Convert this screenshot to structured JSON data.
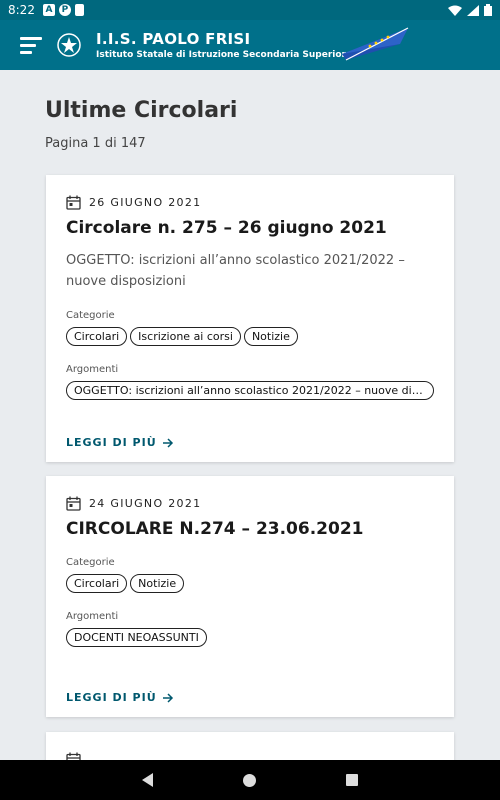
{
  "status_bar": {
    "time": "8:22",
    "icons": [
      "a-icon",
      "p-icon",
      "sim-icon"
    ]
  },
  "header": {
    "title": "I.I.S. PAOLO FRISI",
    "subtitle": "Istituto Statale di Istruzione Secondaria Superiore"
  },
  "page": {
    "title": "Ultime Circolari",
    "pagination": "Pagina 1 di 147"
  },
  "cards": [
    {
      "date": "26 GIUGNO 2021",
      "title": "Circolare n. 275 – 26 giugno 2021",
      "description": "OGGETTO: iscrizioni all’anno scolastico 2021/2022 – nuove disposizioni",
      "categories_label": "Categorie",
      "categories": [
        "Circolari",
        "Iscrizione ai corsi",
        "Notizie"
      ],
      "topics_label": "Argomenti",
      "topics": [
        "OGGETTO: iscrizioni all’anno scolastico 2021/2022 – nuove disposizi..."
      ],
      "read_more": "LEGGI DI PIÙ"
    },
    {
      "date": "24 GIUGNO 2021",
      "title": "CIRCOLARE N.274 – 23.06.2021",
      "categories_label": "Categorie",
      "categories": [
        "Circolari",
        "Notizie"
      ],
      "topics_label": "Argomenti",
      "topics": [
        "DOCENTI NEOASSUNTI"
      ],
      "read_more": "LEGGI DI PIÙ"
    }
  ],
  "colors": {
    "header_bg": "#00708a",
    "link": "#00586e",
    "page_bg": "#e9ecef"
  }
}
